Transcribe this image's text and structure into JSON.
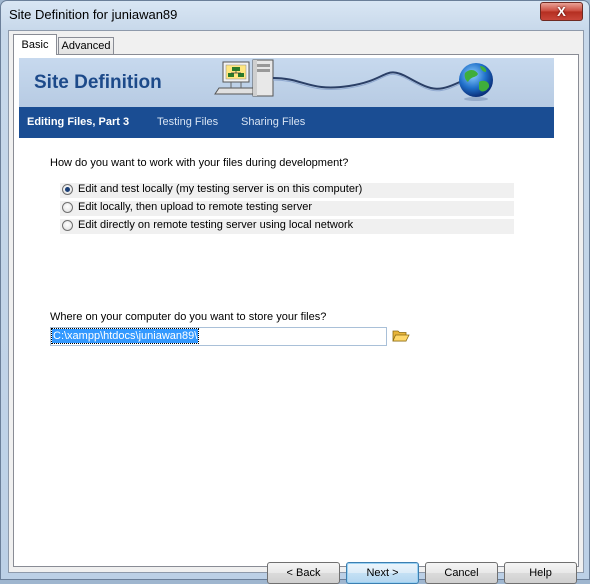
{
  "window": {
    "title": "Site Definition for juniawan89",
    "close_label": "X"
  },
  "tabs": [
    {
      "label": "Basic",
      "active": true
    },
    {
      "label": "Advanced",
      "active": false
    }
  ],
  "banner": {
    "title": "Site Definition"
  },
  "steps": [
    {
      "label": "Editing Files, Part 3",
      "active": true
    },
    {
      "label": "Testing Files",
      "active": false
    },
    {
      "label": "Sharing Files",
      "active": false
    }
  ],
  "question1": "How do you want to work with your files during development?",
  "options": [
    {
      "label": "Edit and test locally (my testing server is on this computer)",
      "checked": true
    },
    {
      "label": "Edit locally, then upload to remote testing server",
      "checked": false
    },
    {
      "label": "Edit directly on remote testing server using local network",
      "checked": false
    }
  ],
  "question2": "Where on your computer do you want to store your files?",
  "path": {
    "value": "C:\\xampp\\htdocs\\juniawan89\\"
  },
  "buttons": {
    "back": "< Back",
    "next": "Next >",
    "cancel": "Cancel",
    "help": "Help"
  },
  "icons": {
    "folder": "folder-open-icon",
    "network": "network-computer-icon",
    "globe": "globe-icon"
  },
  "colors": {
    "step_bar": "#1a4d93",
    "banner_title": "#1d4a8a",
    "selection": "#3399ff"
  }
}
